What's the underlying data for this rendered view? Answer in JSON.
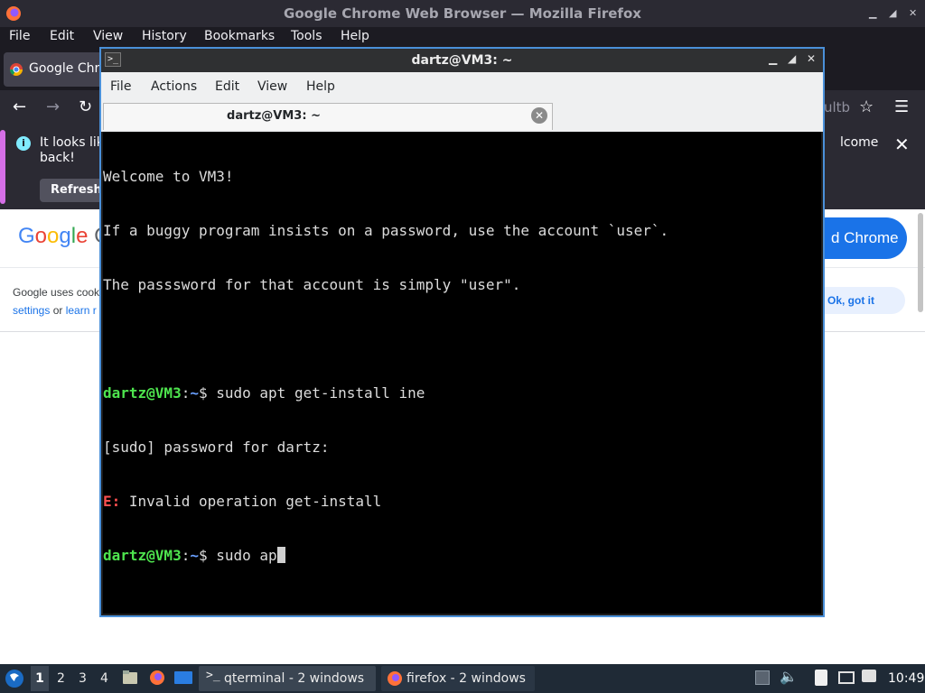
{
  "firefox": {
    "window_title": "Google Chrome Web Browser — Mozilla Firefox",
    "window_controls": [
      "minimize-icon",
      "maximize-icon",
      "close-icon"
    ],
    "menu": [
      "File",
      "Edit",
      "View",
      "History",
      "Bookmarks",
      "Tools",
      "Help"
    ],
    "tab_title": "Google Chro",
    "nav_partial": "ultb",
    "notification": {
      "line1": "It looks lik",
      "line2": "back!",
      "right_text": "lcome",
      "refresh_label": "Refresh"
    }
  },
  "page": {
    "logo_text": "Google C",
    "chrome_button": "d Chrome",
    "cookie_line1": "Google uses cook",
    "cookie_settings": "settings",
    "cookie_or": " or ",
    "cookie_learn": "learn r",
    "ok_button": "Ok, got it"
  },
  "terminal": {
    "window_title": "dartz@VM3: ~",
    "menu": [
      "File",
      "Actions",
      "Edit",
      "View",
      "Help"
    ],
    "tab_title": "dartz@VM3: ~",
    "lines": {
      "l1": "Welcome to VM3!",
      "l2": "If a buggy program insists on a password, use the account `user`.",
      "l3": "The passsword for that account is simply \"user\".",
      "prompt_user": "dartz@VM3",
      "prompt_sep": ":",
      "prompt_path": "~",
      "prompt_dollar": "$ ",
      "cmd1": "sudo apt get-install ine",
      "l6": "[sudo] password for dartz:",
      "err_prefix": "E:",
      "err_text": " Invalid operation get-install",
      "cmd2": "sudo ap"
    }
  },
  "taskbar": {
    "workspaces": [
      "1",
      "2",
      "3",
      "4"
    ],
    "terminal_task": "qterminal - 2 windows",
    "firefox_task": "firefox - 2 windows",
    "clock": "10:49"
  },
  "colors": {
    "terminal_border": "#4a90d9",
    "prompt_green": "#4ee44e",
    "prompt_blue": "#6aa0ff",
    "error_red": "#ff5050",
    "chrome_blue": "#1a73e8"
  }
}
